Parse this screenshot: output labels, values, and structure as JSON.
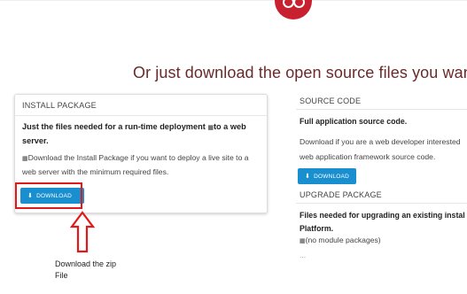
{
  "headline": "Or just download the open source files you want.",
  "install": {
    "title": "INSTALL PACKAGE",
    "bold_line1": "Just the files needed for a run-time deployment ",
    "bold_line1_tail": "to a web",
    "bold_line2": "server.",
    "desc_line1": "Download the Install Package if you want to deploy a live site to a",
    "desc_line2": "web server with the minimum required files.",
    "button": "DOWNLOAD"
  },
  "annotation": {
    "line1": "Download the zip",
    "line2": "File",
    "highlight_color": "#e01a1a"
  },
  "source": {
    "title": "SOURCE CODE",
    "bold": "Full application source code.",
    "text_line1": "Download if you are a web developer interested",
    "text_line2": "web application framework source code.",
    "button": "DOWNLOAD"
  },
  "upgrade": {
    "title": "UPGRADE PACKAGE",
    "bold_line1": "Files needed for upgrading an existing instal",
    "bold_line2": "Platform.",
    "text": "(no module packages)",
    "ellipsis": "..."
  },
  "colors": {
    "brand": "#c8202f",
    "button": "#1a8fd0",
    "headline": "#6b2a2a"
  }
}
